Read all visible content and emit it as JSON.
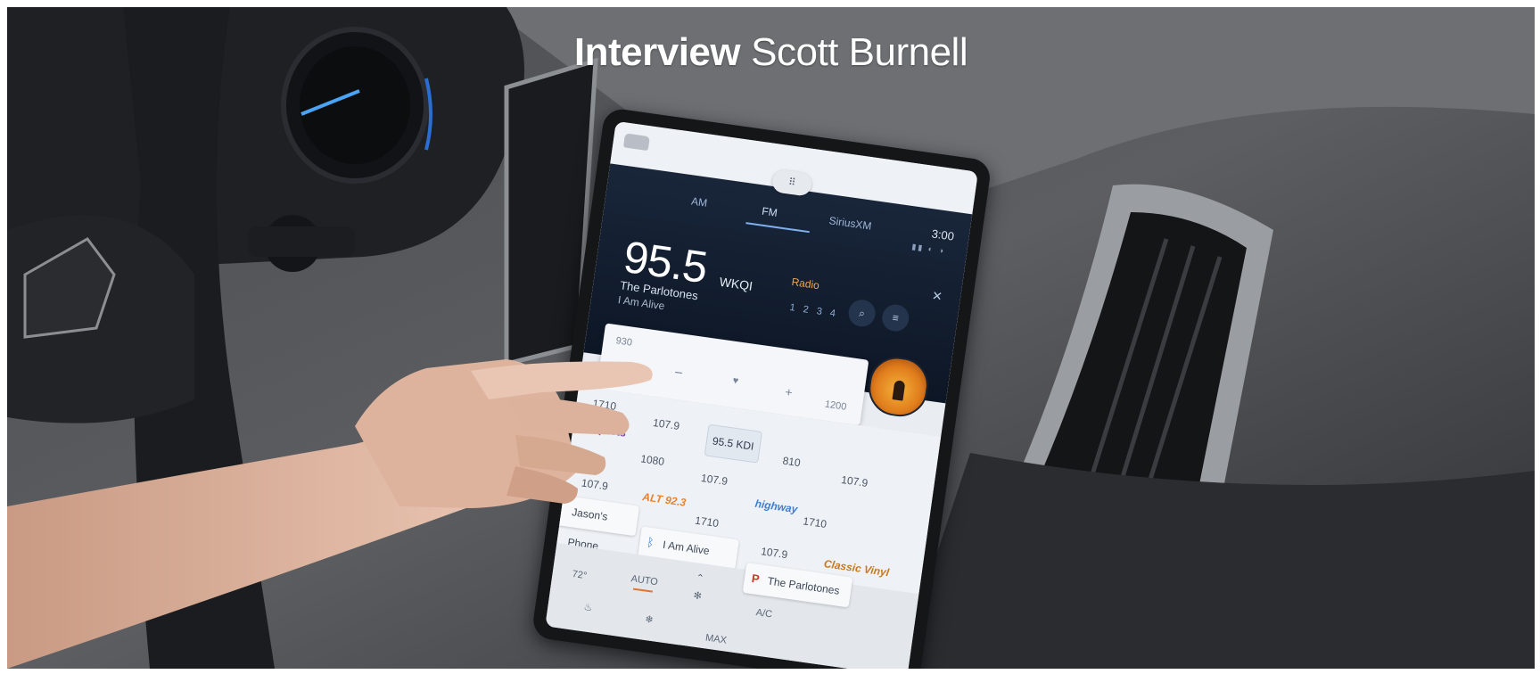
{
  "headline": {
    "lead": "Interview",
    "name": "Scott Burnell"
  },
  "infotainment": {
    "tabs": {
      "am": "AM",
      "fm": "FM",
      "sirius": "SiriusXM"
    },
    "clock": "3:00",
    "frequency": "95.5",
    "station_call": "WKQI",
    "artist": "The Parlotones",
    "song": "I Am Alive",
    "hd_radio_label": "Radio",
    "hd_channels": "1 2 3 4",
    "tuner": {
      "low": "930",
      "high": "1200"
    },
    "presets": [
      "1710",
      "107.9",
      "95.5 KDI",
      "810",
      "107.9",
      "1080",
      "107.9",
      "107.9",
      "1710",
      "1710",
      "107.9"
    ],
    "station_logos": [
      "Sports",
      "ALT 92.3",
      "highway",
      "Classic Vinyl"
    ],
    "sources": {
      "phone": "Jason's Phone",
      "track": "I Am Alive",
      "album": "The Parlotones"
    },
    "climate": {
      "temp": "72°",
      "auto": "AUTO",
      "ac": "A/C",
      "max": "MAX"
    }
  },
  "colors": {
    "accent_blue": "#7fb0ee",
    "hd_orange": "#f2a544",
    "dark_panel": "#19263a"
  }
}
